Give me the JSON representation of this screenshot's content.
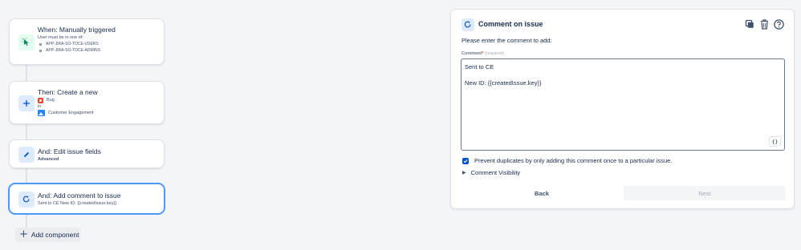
{
  "colors": {
    "accent": "#0052cc",
    "selected_border": "#4c9aff",
    "trigger_icon": "#00875a",
    "bug": "#e5493a"
  },
  "flow": {
    "trigger": {
      "icon": "cursor-click-icon",
      "title": "When: Manually triggered",
      "subtitle": "User must be in one of:",
      "groups": [
        "APP-JIRA-SO-TOCE-USERS",
        "APP-JIRA-SO-TOCE-ADMINS"
      ]
    },
    "create": {
      "icon": "plus-icon",
      "title": "Then: Create a new",
      "issue_type": "Bug",
      "in_label": "in",
      "project": "Customer Engagement"
    },
    "edit": {
      "icon": "pencil-icon",
      "title": "And: Edit issue fields",
      "subtitle": "Advanced"
    },
    "comment": {
      "icon": "comment-refresh-icon",
      "title": "And: Add comment to issue",
      "subtitle": "Sent to CE New ID: {{createdIssue.key}}"
    },
    "add_component": "Add component"
  },
  "panel": {
    "title": "Comment on issue",
    "prompt": "Please enter the comment to add:",
    "field_label": "Comment",
    "required_mark": "*",
    "required_hint": "(required)",
    "comment_lines": [
      "Sent to CE",
      "",
      "New ID: {{createdIssue.key}}"
    ],
    "smart_value_button": "{}",
    "prevent_duplicates": {
      "checked": true,
      "label": "Prevent duplicates by only adding this comment once to a particular issue."
    },
    "visibility_label": "Comment Visibility",
    "back_label": "Back",
    "next_label": "Next"
  }
}
